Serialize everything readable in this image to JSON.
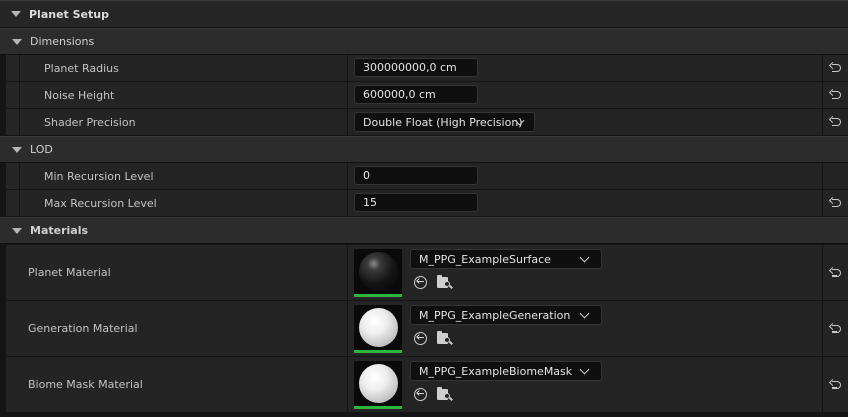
{
  "categories": {
    "planet_setup": "Planet Setup",
    "dimensions": "Dimensions",
    "lod": "LOD",
    "materials": "Materials"
  },
  "dimensions": {
    "planet_radius": {
      "label": "Planet Radius",
      "value": "300000000,0 cm"
    },
    "noise_height": {
      "label": "Noise Height",
      "value": "600000,0 cm"
    },
    "shader_precision": {
      "label": "Shader Precision",
      "value": "Double Float (High Precision)"
    }
  },
  "lod": {
    "min_recursion": {
      "label": "Min Recursion Level",
      "value": "0"
    },
    "max_recursion": {
      "label": "Max Recursion Level",
      "value": "15"
    }
  },
  "materials": {
    "planet": {
      "label": "Planet Material",
      "asset": "M_PPG_ExampleSurface"
    },
    "generation": {
      "label": "Generation Material",
      "asset": "M_PPG_ExampleGeneration"
    },
    "biome_mask": {
      "label": "Biome Mask Material",
      "asset": "M_PPG_ExampleBiomeMask"
    }
  },
  "icons": {
    "expand": "chevron-down-icon",
    "reset": "reset-to-default-icon",
    "use_selected": "use-selected-asset-icon",
    "browse": "browse-to-asset-icon"
  },
  "colors": {
    "thumbnail_bar": "#2fb541"
  }
}
